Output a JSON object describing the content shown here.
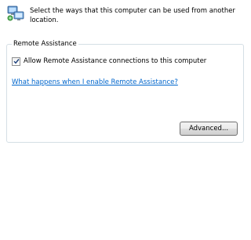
{
  "header": {
    "icon": "computer-network-icon",
    "description": "Select the ways that this computer can be used from another location."
  },
  "remote_assistance": {
    "group_title": "Remote Assistance",
    "allow_checkbox": {
      "label": "Allow Remote Assistance connections to this computer",
      "checked": true
    },
    "help_link": "What happens when I enable Remote Assistance?",
    "advanced_button": "Advanced..."
  },
  "colors": {
    "link": "#0066cc",
    "group_border": "#d5dfe5"
  }
}
